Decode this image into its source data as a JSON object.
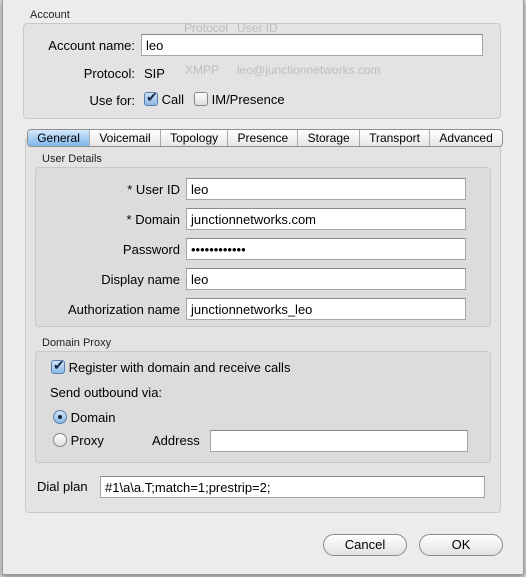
{
  "background": {
    "col1": "Protocol",
    "col2": "User ID",
    "protocol": "XMPP",
    "user": "leo@junctionnetworks.com"
  },
  "account": {
    "section_title": "Account",
    "name_label": "Account name:",
    "name_value": "leo",
    "protocol_label": "Protocol:",
    "protocol_value": "SIP",
    "use_for_label": "Use for:",
    "call_label": "Call",
    "call_checked": true,
    "im_label": "IM/Presence",
    "im_checked": false
  },
  "tabs": [
    {
      "label": "General",
      "active": true
    },
    {
      "label": "Voicemail"
    },
    {
      "label": "Topology"
    },
    {
      "label": "Presence"
    },
    {
      "label": "Storage"
    },
    {
      "label": "Transport"
    },
    {
      "label": "Advanced"
    }
  ],
  "user_details": {
    "title": "User Details",
    "user_id_label": "* User ID",
    "user_id": "leo",
    "domain_label": "* Domain",
    "domain": "junctionnetworks.com",
    "password_label": "Password",
    "password": "••••••••••••",
    "display_name_label": "Display name",
    "display_name": "leo",
    "auth_name_label": "Authorization name",
    "auth_name": "junctionnetworks_leo"
  },
  "domain_proxy": {
    "title": "Domain Proxy",
    "register_label": "Register with domain and receive calls",
    "register_checked": true,
    "send_via_label": "Send outbound via:",
    "domain_label": "Domain",
    "proxy_label": "Proxy",
    "selected": "Domain",
    "address_label": "Address",
    "address_value": ""
  },
  "dial_plan": {
    "label": "Dial plan",
    "value": "#1\\a\\a.T;match=1;prestrip=2;"
  },
  "buttons": {
    "cancel": "Cancel",
    "ok": "OK"
  }
}
